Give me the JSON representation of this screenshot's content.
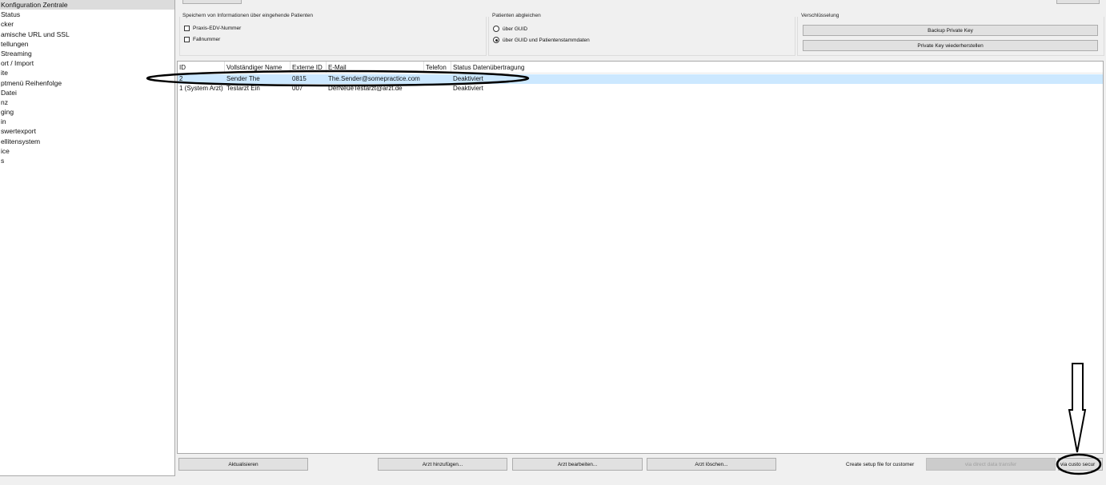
{
  "sidebar": {
    "items": [
      {
        "label": "Konfiguration Zentrale",
        "selected": true
      },
      {
        "label": "Status"
      },
      {
        "label": "cker"
      },
      {
        "label": "amische URL und SSL"
      },
      {
        "label": "tellungen"
      },
      {
        "label": "Streaming"
      },
      {
        "label": "ort / Import"
      },
      {
        "label": "ite"
      },
      {
        "label": "ptmenü Reihenfolge"
      },
      {
        "label": "Datei"
      },
      {
        "label": "nz"
      },
      {
        "label": "ging"
      },
      {
        "label": "in"
      },
      {
        "label": "swertexport"
      },
      {
        "label": "ellitensystem"
      },
      {
        "label": "ice"
      },
      {
        "label": "s"
      }
    ]
  },
  "groups": {
    "storage": {
      "title": "Speichern von Informationen über eingehende Patienten",
      "options": [
        {
          "label": "Praxis-EDV-Nummer",
          "checked": false
        },
        {
          "label": "Fallnummer",
          "checked": false
        }
      ]
    },
    "match": {
      "title": "Patienten abgleichen",
      "options": [
        {
          "label": "über GUID",
          "selected": false
        },
        {
          "label": "über GUID und Patientenstammdaten",
          "selected": true
        }
      ]
    },
    "encryption": {
      "title": "Verschlüsselung",
      "backup_label": "Backup Private Key",
      "restore_label": "Private Key wiederherstellen"
    }
  },
  "table": {
    "columns": [
      "ID",
      "Vollständiger Name",
      "Externe ID",
      "E-Mail",
      "Telefon",
      "Status Datenübertragung"
    ],
    "rows": [
      {
        "id": "2",
        "name": "Sender The",
        "ext_id": "0815",
        "email": "The.Sender@somepractice.com",
        "phone": "",
        "status": "Deaktiviert",
        "selected": true
      },
      {
        "id": "1 (System Arzt)",
        "name": "Testarzt Ein",
        "ext_id": "007",
        "email": "DerNeueTestarzt@arzt.de",
        "phone": "",
        "status": "Deaktiviert",
        "selected": false
      }
    ]
  },
  "footer": {
    "refresh_label": "Aktualisieren",
    "add_label": "Arzt hinzufügen...",
    "edit_label": "Arzt bearbeiten...",
    "delete_label": "Arzt löschen...",
    "setup_label": "Create setup file for customer",
    "direct_label": "via direct data transfer",
    "custom_label": "via custo secur"
  },
  "colors": {
    "selection": "#cce8ff",
    "annotation": "#000000"
  }
}
